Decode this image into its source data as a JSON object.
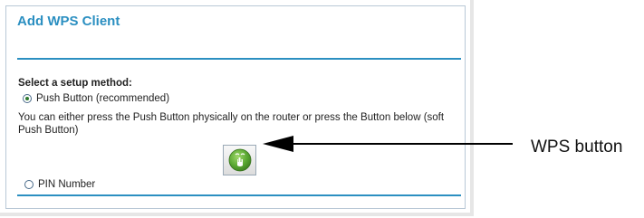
{
  "page": {
    "title": "Add WPS Client"
  },
  "setup": {
    "label": "Select a setup method:",
    "options": [
      {
        "label": "Push Button (recommended)",
        "selected": true
      },
      {
        "label": "PIN Number",
        "selected": false
      }
    ],
    "description": "You can either press the Push Button physically on the router or press the Button below (soft Push Button)",
    "wps_button_icon": "wps-icon"
  },
  "callout": {
    "label": "WPS button"
  },
  "colors": {
    "accent": "#2b8fc1",
    "wps_green": "#5aa832"
  }
}
